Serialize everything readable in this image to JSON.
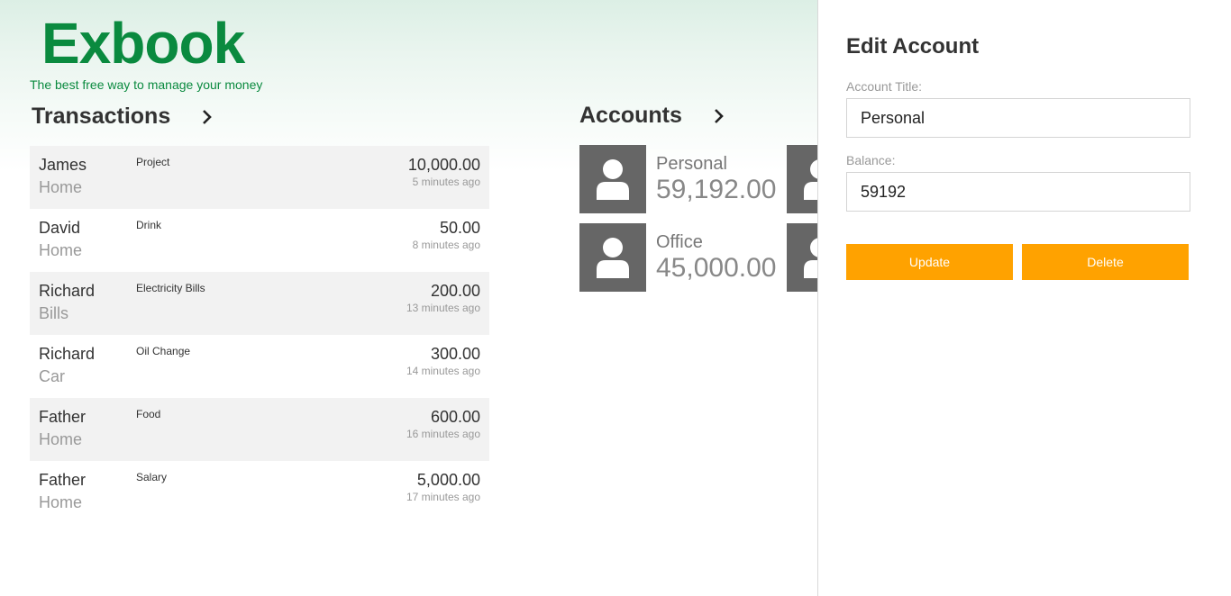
{
  "logo": {
    "title": "Exbook",
    "tagline": "The best free way to manage your money"
  },
  "transactions": {
    "title": "Transactions",
    "items": [
      {
        "name": "James",
        "account": "Home",
        "category": "Project",
        "amount": "10,000.00",
        "time": "5 minutes ago"
      },
      {
        "name": "David",
        "account": "Home",
        "category": "Drink",
        "amount": "50.00",
        "time": "8 minutes ago"
      },
      {
        "name": "Richard",
        "account": "Bills",
        "category": "Electricity Bills",
        "amount": "200.00",
        "time": "13 minutes ago"
      },
      {
        "name": "Richard",
        "account": "Car",
        "category": "Oil Change",
        "amount": "300.00",
        "time": "14 minutes ago"
      },
      {
        "name": "Father",
        "account": "Home",
        "category": "Food",
        "amount": "600.00",
        "time": "16 minutes ago"
      },
      {
        "name": "Father",
        "account": "Home",
        "category": "Salary",
        "amount": "5,000.00",
        "time": "17 minutes ago"
      }
    ]
  },
  "accounts": {
    "title": "Accounts",
    "items": [
      {
        "name": "Personal",
        "balance": "59,192.00"
      },
      {
        "name": "Office",
        "balance": "45,000.00"
      }
    ]
  },
  "edit_account": {
    "title": "Edit Account",
    "title_label": "Account Title:",
    "title_value": "Personal",
    "balance_label": "Balance:",
    "balance_value": "59192",
    "update_label": "Update",
    "delete_label": "Delete"
  },
  "colors": {
    "brand_green": "#0a8a3f",
    "button_orange": "#ffa200",
    "avatar_gray": "#666666"
  },
  "icons": {
    "section_nav": "chevron-right-icon",
    "account_avatar": "user-icon"
  }
}
